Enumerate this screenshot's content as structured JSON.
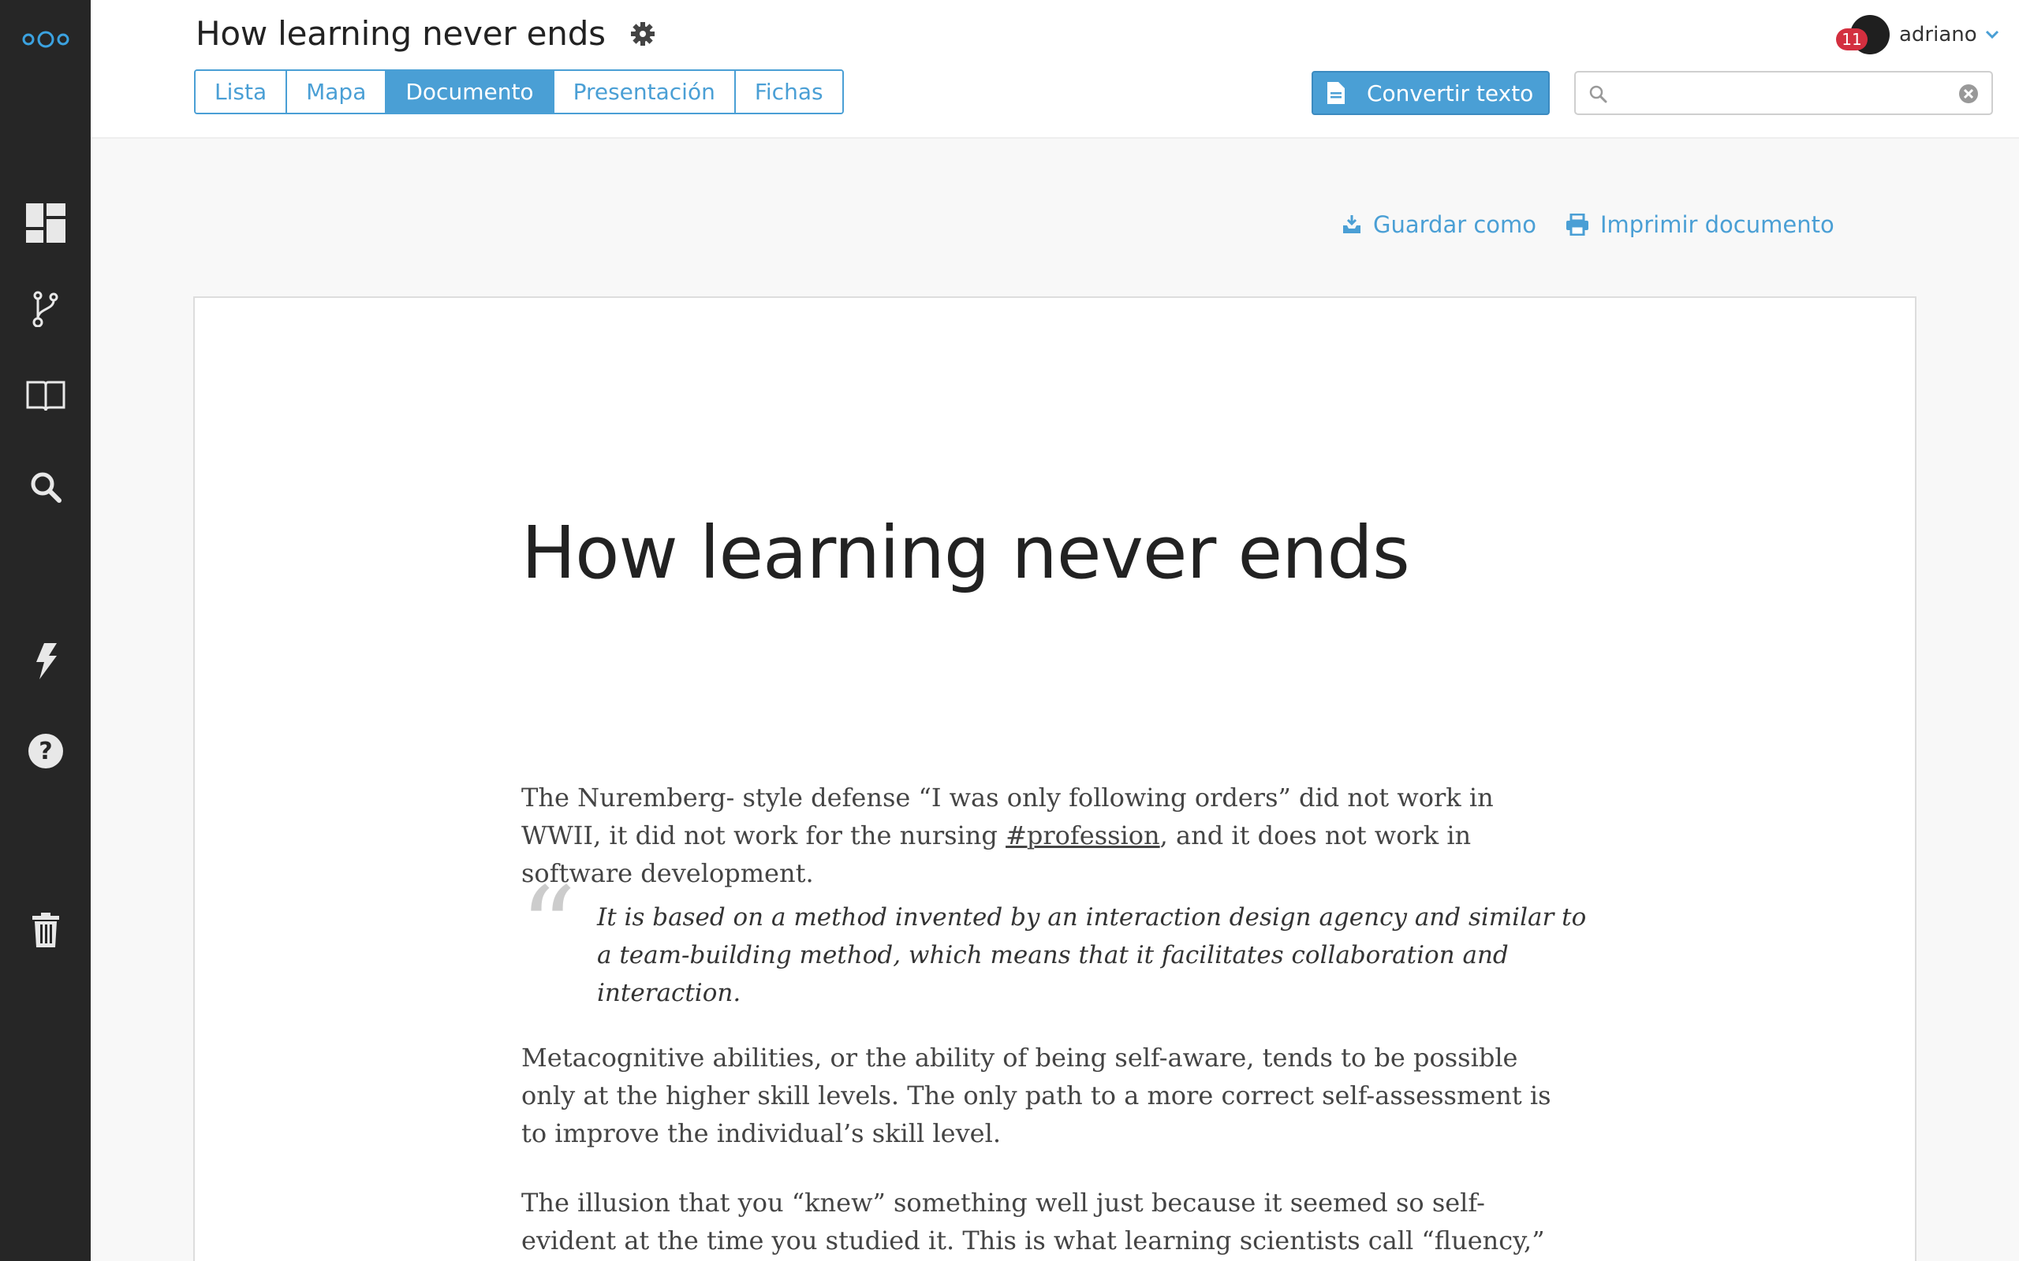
{
  "header": {
    "title": "How learning never ends",
    "tabs": [
      {
        "label": "Lista",
        "active": false
      },
      {
        "label": "Mapa",
        "active": false
      },
      {
        "label": "Documento",
        "active": true
      },
      {
        "label": "Presentación",
        "active": false
      },
      {
        "label": "Fichas",
        "active": false
      }
    ],
    "convert_label": "Convertir texto",
    "search": {
      "value": "",
      "placeholder": ""
    },
    "user": {
      "name": "adriano",
      "notifications": "11"
    }
  },
  "sidebar": {
    "items": [
      {
        "icon": "logo-icon"
      },
      {
        "icon": "dashboard-icon"
      },
      {
        "icon": "branch-icon"
      },
      {
        "icon": "book-icon"
      },
      {
        "icon": "search-icon"
      },
      {
        "icon": "lightning-icon"
      },
      {
        "icon": "help-icon"
      },
      {
        "icon": "trash-icon"
      }
    ]
  },
  "actions": {
    "save_as": "Guardar como",
    "print": "Imprimir documento"
  },
  "document": {
    "title": "How learning never ends",
    "p1_before": "The Nuremberg- style defense “I was only following orders” did not work in WWII, it did not work for the nursing ",
    "p1_hashtag": "#profession",
    "p1_after": ", and it does not work in software development.",
    "quote": "It is based on a method invented by an interaction design agency and similar to a team-building method, which means that it facilitates collaboration and interaction.",
    "p2": "Metacognitive abilities, or the ability of being self-aware, tends to be possible only at the higher skill levels. The only path to a more correct self-assessment is to improve the individual’s skill level.",
    "p3": "The illusion that you “knew” something well just because it seemed so self-evident at the time you studied it. This is what learning scientists call “fluency,” the assumption that"
  },
  "colors": {
    "accent": "#4a9fd5",
    "sidebar": "#262626",
    "badge": "#d32f3f"
  }
}
